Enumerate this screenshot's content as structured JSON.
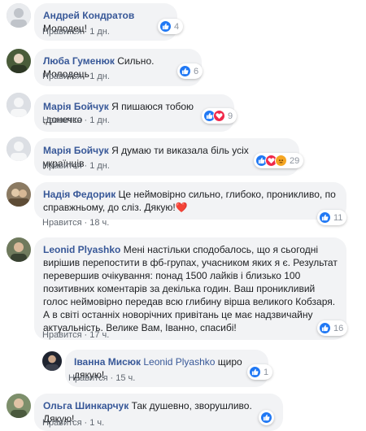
{
  "comments": [
    {
      "author": "Андрей Кондратов",
      "text": "Молодец!",
      "like_label": "Нравится",
      "time": "1 дн.",
      "reaction_count": "4",
      "reactions": [
        "like-icon"
      ]
    },
    {
      "author": "Люба Гуменюк",
      "text": "Сильно. Молодець",
      "like_label": "Нравится",
      "time": "1 дн.",
      "reaction_count": "6",
      "reactions": [
        "like-icon"
      ]
    },
    {
      "author": "Марія Бойчук",
      "text": "Я пишаюся тобою ,донечко",
      "like_label": "Нравится",
      "time": "1 дн.",
      "reaction_count": "9",
      "reactions": [
        "like-icon",
        "love-icon"
      ]
    },
    {
      "author": "Марія Бойчук",
      "text": "Я думаю ти виказала біль усіх українців",
      "like_label": "Нравится",
      "time": "1 дн.",
      "reaction_count": "29",
      "reactions": [
        "like-icon",
        "love-icon",
        "angry-icon"
      ]
    },
    {
      "author": "Надія Федорик",
      "text": "Це неймовірно сильно, глибоко, проникливо, по справжньому, до сліз. Дякую!❤️",
      "like_label": "Нравится",
      "time": "18 ч.",
      "reaction_count": "11",
      "reactions": [
        "like-icon"
      ]
    },
    {
      "author": "Leonid Plyashko",
      "text": "Мені настільки сподобалось, що я сьогодні вирішив перепостити в фб-групах, учасником яких я є. Результат перевершив очікування: понад 1500 лайків і близько 100 позитивних коментарів за декілька годин. Ваш проникливий голос неймовірно передав всю глибину вірша великого Кобзаря. А в світі останніх новорічних привітань це має надзвичайну актуальність. Велике Вам, Іванно, спасибі!",
      "like_label": "Нравится",
      "time": "17 ч.",
      "reaction_count": "16",
      "reactions": [
        "like-icon"
      ]
    },
    {
      "author": "Іванна Мисюк",
      "mention": "Leonid Plyashko",
      "text": "щиро дякую!",
      "like_label": "Нравится",
      "time": "15 ч.",
      "reaction_count": "1",
      "reactions": [
        "like-icon"
      ]
    },
    {
      "author": "Ольга Шинкарчук",
      "text": "Так душевно, зворушливо. Дякую!",
      "like_label": "Нравится",
      "time": "1 ч.",
      "reaction_count": "",
      "reactions": [
        "like-icon"
      ]
    }
  ],
  "colors": {
    "author": "#385898",
    "bubble": "#f2f3f5",
    "meta": "#606770",
    "like_reaction": "#2078f4",
    "love_reaction": "#f0284a",
    "angry_reaction": "#f5a623"
  }
}
